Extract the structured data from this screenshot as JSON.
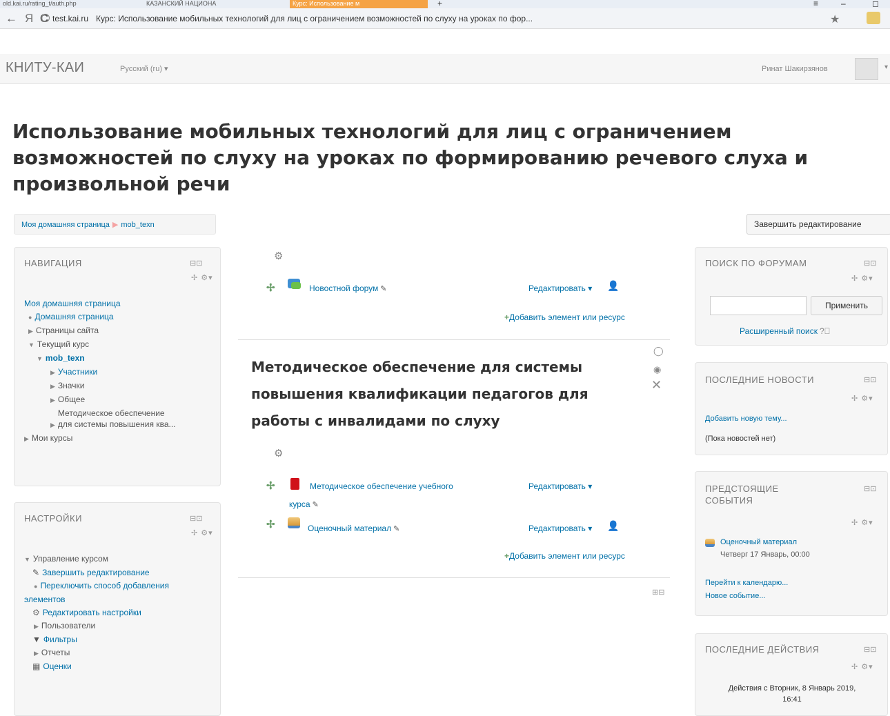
{
  "browser": {
    "tabs": [
      {
        "label": "old.kai.ru/rating_t/auth.php"
      },
      {
        "label": "КАЗАНСКИЙ НАЦИОНА"
      },
      {
        "label": "Курс: Использование м"
      }
    ],
    "new_tab": "+",
    "window_controls": [
      "≡",
      "–",
      "◻"
    ],
    "back": "←",
    "yandex": "Я",
    "reload": "C",
    "host": "test.kai.ru",
    "page_title": "Курс: Использование мобильных технологий для лиц с ограничением возможностей по слуху на уроках по фор...",
    "star": "★"
  },
  "header": {
    "brand": "КНИТУ-КАИ",
    "language": "Русский (ru) ▾",
    "user_name": "Ринат Шакирзянов"
  },
  "page": {
    "title": "Использование мобильных технологий для лиц с ограничением возможностей по слуху на уроках по формированию речевого слуха и произвольной речи",
    "breadcrumb": [
      "Моя домашняя страница",
      "mob_texn"
    ],
    "breadcrumb_sep": "▶",
    "finish_editing": "Завершить редактирование"
  },
  "nav_block": {
    "title": "НАВИГАЦИЯ",
    "items": [
      {
        "label": "Моя домашняя страница"
      },
      {
        "label": "Домашняя страница"
      },
      {
        "label": "Страницы сайта"
      },
      {
        "label": "Текущий курс"
      },
      {
        "label": "mob_texn"
      },
      {
        "label": "Участники"
      },
      {
        "label": "Значки"
      },
      {
        "label": "Общее"
      },
      {
        "label": "Методическое обеспечение"
      },
      {
        "label": "для системы повышения ква..."
      },
      {
        "label": "Мои курсы"
      }
    ]
  },
  "settings_block": {
    "title": "НАСТРОЙКИ",
    "items": [
      {
        "label": "Управление курсом"
      },
      {
        "label": "Завершить редактирование"
      },
      {
        "label": "Переключить способ добавления"
      },
      {
        "label": "элементов"
      },
      {
        "label": "Редактировать настройки"
      },
      {
        "label": "Пользователи"
      },
      {
        "label": "Фильтры"
      },
      {
        "label": "Отчеты"
      },
      {
        "label": "Оценки"
      }
    ]
  },
  "course": {
    "section0": {
      "activity": "Новостной форум",
      "edit": "Редактировать ▾",
      "add": "Добавить элемент или ресурс"
    },
    "section1": {
      "title": "Методическое обеспечение для системы повышения квалификации педагогов для работы с инвалидами по слуху",
      "activity1_line1": "Методическое обеспечение учебного",
      "activity1_line2": "курса",
      "activity2": "Оценочный материал",
      "edit": "Редактировать ▾",
      "add": "Добавить элемент или ресурс"
    }
  },
  "forum_search": {
    "title": "ПОИСК ПО ФОРУМАМ",
    "input_value": "",
    "apply": "Применить",
    "advanced": "Расширенный поиск"
  },
  "news_block": {
    "title": "ПОСЛЕДНИЕ НОВОСТИ",
    "add": "Добавить новую тему...",
    "empty": "(Пока новостей нет)"
  },
  "events_block": {
    "title_line1": "ПРЕДСТОЯЩИЕ",
    "title_line2": "СОБЫТИЯ",
    "event_name": "Оценочный материал",
    "event_date": "Четверг 17 Январь, 00:00",
    "calendar": "Перейти к календарю...",
    "new_event": "Новое событие..."
  },
  "activity_block": {
    "title": "ПОСЛЕДНИЕ ДЕЙСТВИЯ",
    "since_line1": "Действия с Вторник, 8 Январь 2019,",
    "since_line2": "16:41"
  }
}
